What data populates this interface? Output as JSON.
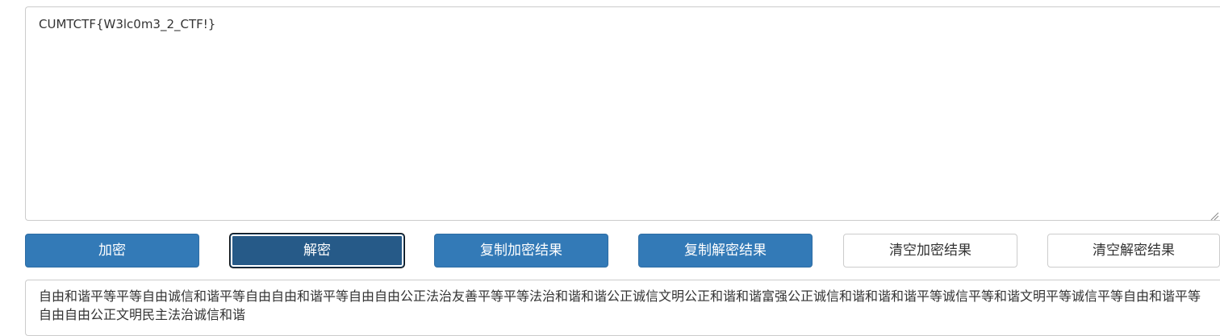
{
  "plaintext": {
    "value": "CUMTCTF{W3lc0m3_2_CTF!}"
  },
  "buttons": {
    "encrypt": "加密",
    "decrypt": "解密",
    "copy_encrypt": "复制加密结果",
    "copy_decrypt": "复制解密结果",
    "clear_encrypt": "清空加密结果",
    "clear_decrypt": "清空解密结果"
  },
  "ciphertext": {
    "value": "自由和谐平等平等自由诚信和谐平等自由自由和谐平等自由自由公正法治友善平等平等法治和谐和谐公正诚信文明公正和谐和谐富强公正诚信和谐和谐和谐平等诚信平等和谐文明平等诚信平等自由和谐平等自由自由公正文明民主法治诚信和谐"
  },
  "colors": {
    "primary": "#337ab7",
    "primary_active": "#265a88",
    "border": "#cccccc",
    "text": "#333333"
  },
  "icons": {
    "resize": "resize-grip-icon"
  }
}
